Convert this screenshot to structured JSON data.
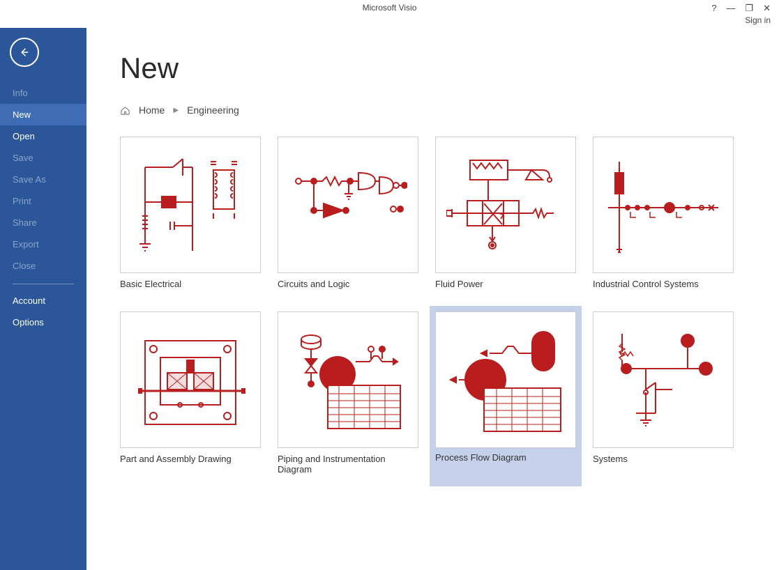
{
  "app_title": "Microsoft Visio",
  "window_controls": {
    "help": "?",
    "minimize": "—",
    "restore": "❐",
    "close": "✕"
  },
  "signin_label": "Sign in",
  "page_title": "New",
  "sidebar": {
    "items": [
      {
        "label": "Info",
        "dim": true
      },
      {
        "label": "New",
        "active": true
      },
      {
        "label": "Open"
      },
      {
        "label": "Save",
        "dim": true
      },
      {
        "label": "Save As",
        "dim": true
      },
      {
        "label": "Print",
        "dim": true
      },
      {
        "label": "Share",
        "dim": true
      },
      {
        "label": "Export",
        "dim": true
      },
      {
        "label": "Close",
        "dim": true
      }
    ],
    "footer": [
      {
        "label": "Account"
      },
      {
        "label": "Options"
      }
    ]
  },
  "breadcrumbs": {
    "home_label": "Home",
    "current": "Engineering"
  },
  "templates": [
    {
      "id": "basic-electrical",
      "label": "Basic Electrical",
      "selected": false
    },
    {
      "id": "circuits-and-logic",
      "label": "Circuits and Logic",
      "selected": false
    },
    {
      "id": "fluid-power",
      "label": "Fluid Power",
      "selected": false
    },
    {
      "id": "industrial-control-systems",
      "label": "Industrial Control Systems",
      "selected": false
    },
    {
      "id": "part-and-assembly-drawing",
      "label": "Part and Assembly Drawing",
      "selected": false
    },
    {
      "id": "piping-and-instrumentation-diagram",
      "label": "Piping and Instrumentation Diagram",
      "selected": false
    },
    {
      "id": "process-flow-diagram",
      "label": "Process Flow Diagram",
      "selected": true
    },
    {
      "id": "systems",
      "label": "Systems",
      "selected": false
    }
  ],
  "accent_color": "#b91d1d"
}
